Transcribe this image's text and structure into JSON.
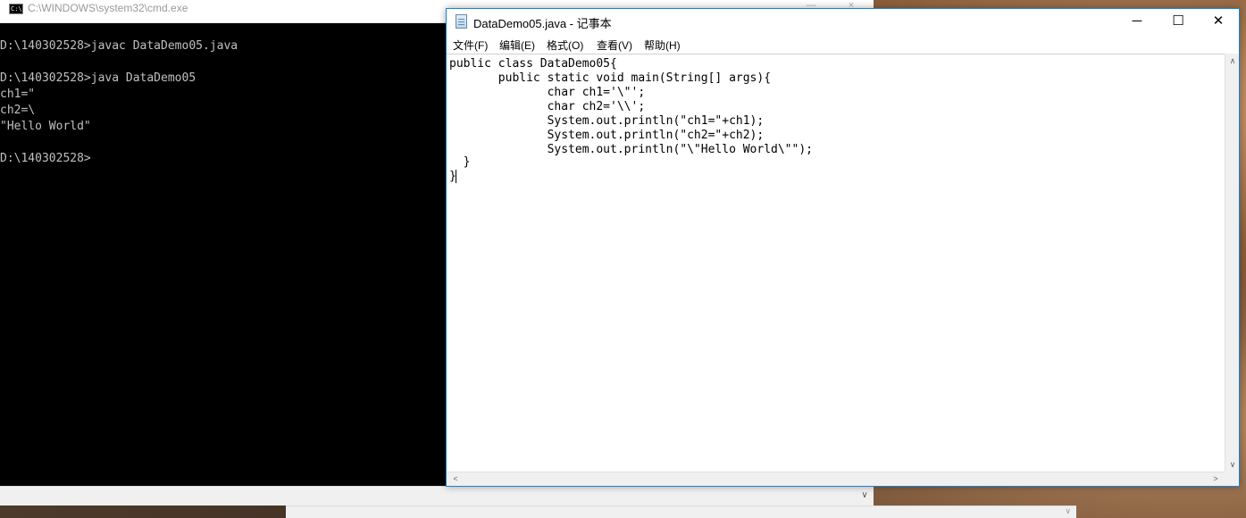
{
  "cmd": {
    "title": "C:\\WINDOWS\\system32\\cmd.exe",
    "icon_text": "C:\\",
    "lines": [
      "D:\\140302528>javac DataDemo05.java",
      "",
      "D:\\140302528>java DataDemo05",
      "ch1=\"",
      "ch2=\\",
      "\"Hello World\"",
      "",
      "D:\\140302528>"
    ],
    "minimize": "—",
    "close": "×",
    "scroll_arrow": "∨"
  },
  "notepad": {
    "title": "DataDemo05.java - 记事本",
    "controls": {
      "minimize": "─",
      "maximize": "☐",
      "close": "✕"
    },
    "menu": [
      "文件(F)",
      "编辑(E)",
      "格式(O)",
      "查看(V)",
      "帮助(H)"
    ],
    "code_lines": [
      "public class DataDemo05{",
      "       public static void main(String[] args){",
      "              char ch1='\\\"';",
      "              char ch2='\\\\';",
      "              System.out.println(\"ch1=\"+ch1);",
      "              System.out.println(\"ch2=\"+ch2);",
      "              System.out.println(\"\\\"Hello World\\\"\");",
      "  }",
      "}"
    ],
    "scroll_up": "∧",
    "scroll_down": "∨",
    "scroll_left": "<",
    "scroll_right": ">"
  }
}
